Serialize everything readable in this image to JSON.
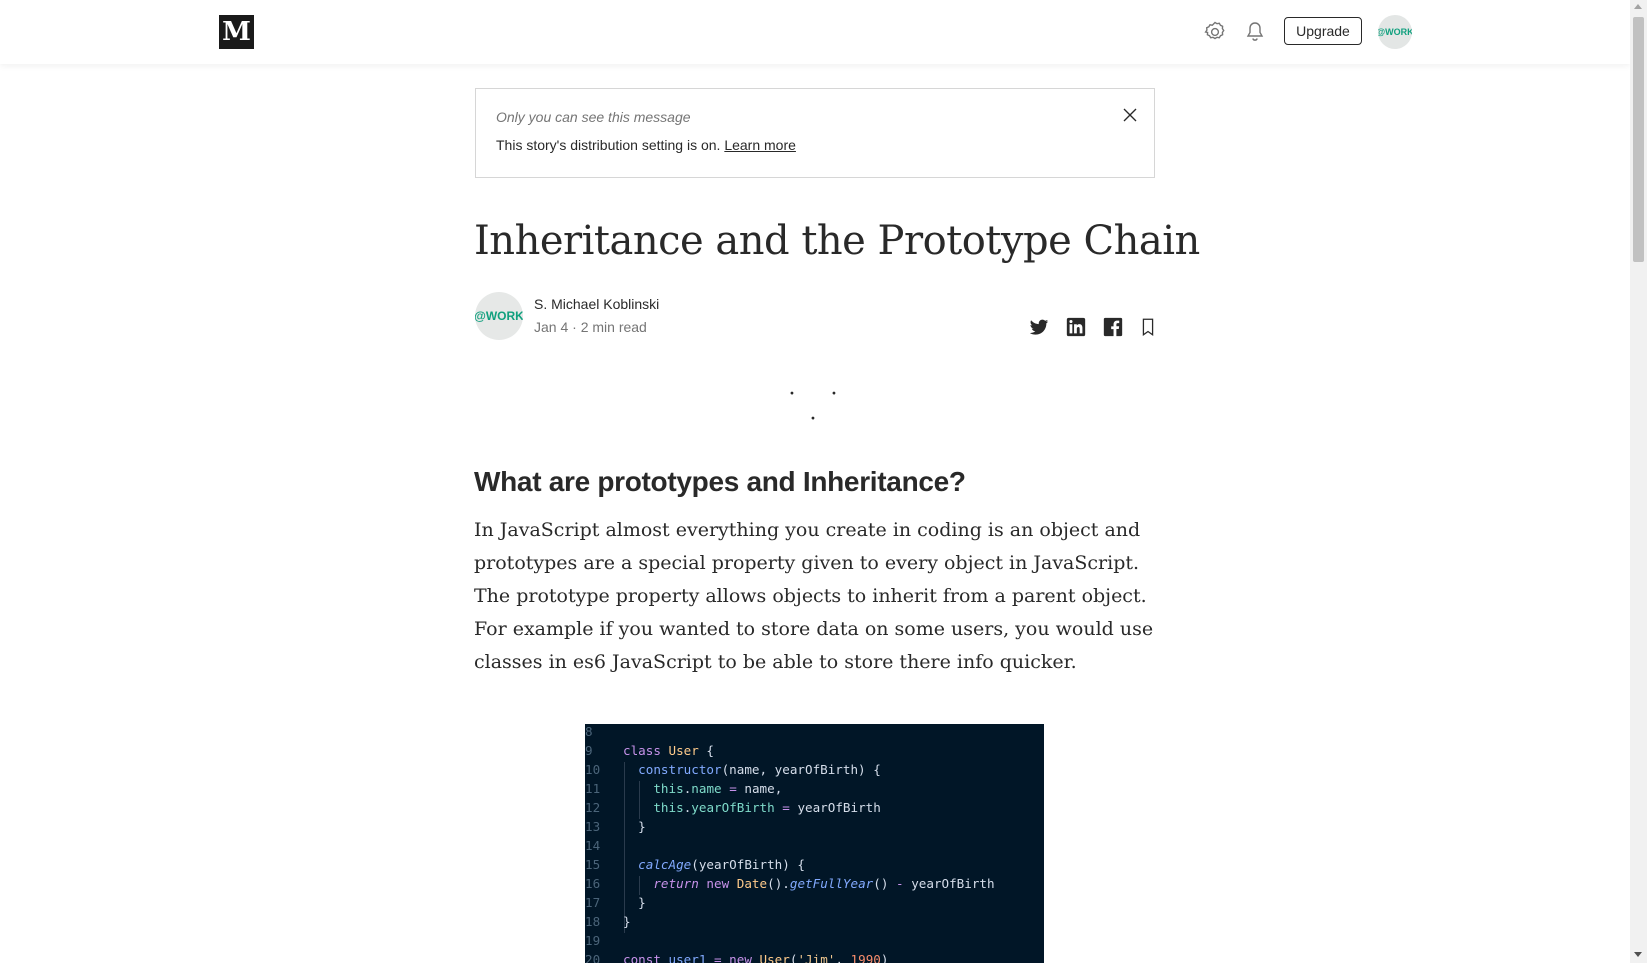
{
  "topbar": {
    "logo_text": "M",
    "upgrade_label": "Upgrade",
    "avatar_text": "@WORK"
  },
  "notice": {
    "private_label": "Only you can see this message",
    "message": "This story's distribution setting is on.",
    "link": "Learn more"
  },
  "article": {
    "title": "Inheritance and the Prototype Chain",
    "author": {
      "name": "S. Michael Koblinski",
      "meta": "Jan 4 · 2 min read",
      "avatar_text": "@WORK"
    },
    "separator": "· · ·",
    "heading": "What are prototypes and Inheritance?",
    "paragraph": "In JavaScript almost everything you create in coding is an object and prototypes are a special property given to every object in JavaScript. The prototype property allows objects to inherit from a parent object. For example if you wanted to store data on some users, you would use classes in es6 JavaScript to be able to store there info quicker."
  },
  "share": {
    "icons": [
      "twitter-icon",
      "linkedin-icon",
      "facebook-icon",
      "bookmark-icon"
    ]
  },
  "code": {
    "line_numbers": [
      "8",
      "9",
      "10",
      "11",
      "12",
      "13",
      "14",
      "15",
      "16",
      "17",
      "18",
      "19",
      "20"
    ],
    "lines": {
      "l9_a": "class ",
      "l9_b": "User",
      "l9_c": " {",
      "l10_a": "constructor",
      "l10_b": "(name, yearOfBirth) {",
      "l11_a": "this",
      "l11_b": ".",
      "l11_c": "name",
      "l11_d": " = ",
      "l11_e": "name,",
      "l12_a": "this",
      "l12_b": ".",
      "l12_c": "yearOfBirth",
      "l12_d": " = ",
      "l12_e": "yearOfBirth",
      "l13": "}",
      "l15_a": "calcAge",
      "l15_b": "(yearOfBirth) {",
      "l16_a": "return",
      "l16_b": " new ",
      "l16_c": "Date",
      "l16_d": "().",
      "l16_e": "getFullYear",
      "l16_f": "() ",
      "l16_g": "-",
      "l16_h": " yearOfBirth",
      "l17": "}",
      "l18": "}",
      "l20_a": "const ",
      "l20_b": "user1",
      "l20_c": " = ",
      "l20_d": "new ",
      "l20_e": "User",
      "l20_f": "(",
      "l20_g": "'Jim'",
      "l20_h": ", ",
      "l20_i": "1990",
      "l20_j": ")"
    }
  },
  "colors": {
    "code_bg": "#011627",
    "text": "#292929",
    "muted": "#757575",
    "avatar_green": "#10a07e"
  }
}
